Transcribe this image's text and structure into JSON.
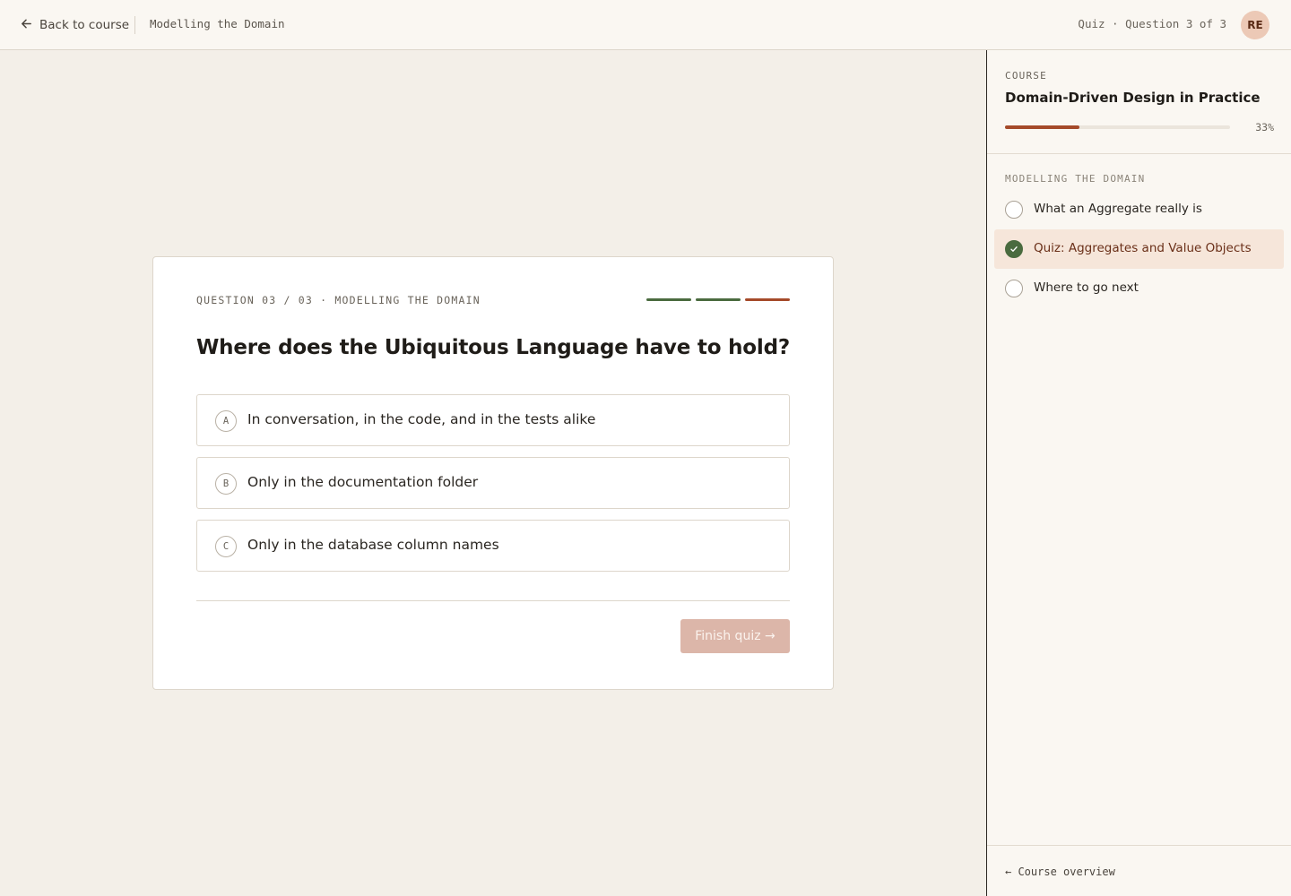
{
  "topbar": {
    "back_label": "Back to course",
    "breadcrumb": "Modelling the Domain",
    "quiz_status": "Quiz · Question 3 of 3",
    "avatar_initials": "RE"
  },
  "quiz": {
    "meta": "QUESTION 03 / 03 · MODELLING THE DOMAIN",
    "progress_segments": [
      {
        "state": "done",
        "color": "#4a6b3f"
      },
      {
        "state": "done",
        "color": "#4a6b3f"
      },
      {
        "state": "current",
        "color": "#a54a2a"
      }
    ],
    "question": "Where does the Ubiquitous Language have to hold?",
    "options": [
      {
        "letter": "A",
        "text": "In conversation, in the code, and in the tests alike"
      },
      {
        "letter": "B",
        "text": "Only in the documentation folder"
      },
      {
        "letter": "C",
        "text": "Only in the database column names"
      }
    ],
    "finish_label": "Finish quiz →"
  },
  "sidebar": {
    "kicker": "COURSE",
    "course_title": "Domain-Driven Design in Practice",
    "progress_fraction": 0.33,
    "progress_label": "33%",
    "section_title": "MODELLING THE DOMAIN",
    "lessons": [
      {
        "label": "What an Aggregate really is",
        "done": false,
        "active": false
      },
      {
        "label": "Quiz: Aggregates and Value Objects",
        "done": true,
        "active": true
      },
      {
        "label": "Where to go next",
        "done": false,
        "active": false
      }
    ],
    "footer_link": "← Course overview"
  },
  "colors": {
    "accent": "#a54a2a",
    "success": "#4a6b3f",
    "background": "#f3efe8"
  }
}
